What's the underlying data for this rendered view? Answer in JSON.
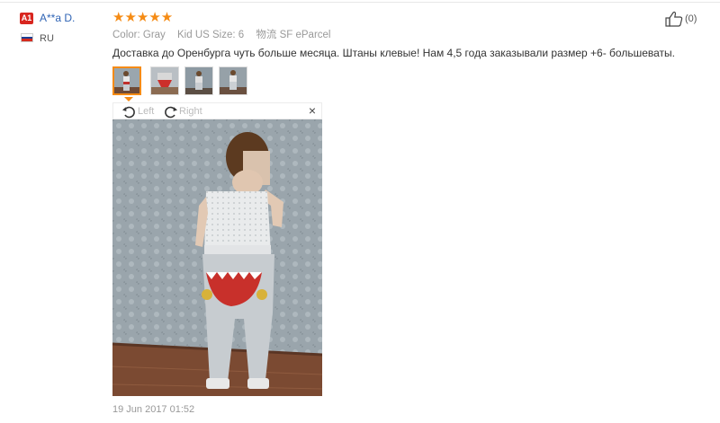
{
  "reviewer": {
    "level_badge": "A1",
    "name": "A**a D.",
    "country": "RU",
    "flag_colors": [
      "#ffffff",
      "#1c3f94",
      "#d52b1e"
    ]
  },
  "review": {
    "rating": 5,
    "stars": "★★★★★",
    "color_label": "Color:",
    "color_value": "Gray",
    "size_label": "Kid US Size:",
    "size_value": "6",
    "logistics_label": "物流",
    "logistics_value": "SF eParcel",
    "text": "Доставка до Оренбурга чуть больше месяца. Штаны клевые! Нам 4,5 года заказывали размер +6- большеваты.",
    "date": "19 Jun 2017 01:52",
    "helpful_count": "(0)"
  },
  "viewer": {
    "rotate_left_label": "Left",
    "rotate_right_label": "Right",
    "close_symbol": "×",
    "thumbnails": [
      "photo-1",
      "photo-2",
      "photo-3",
      "photo-4"
    ],
    "active_index": 0
  },
  "colors": {
    "accent": "#f58b14",
    "link": "#2f64b5",
    "badge": "#d8261f",
    "muted": "#999999"
  }
}
